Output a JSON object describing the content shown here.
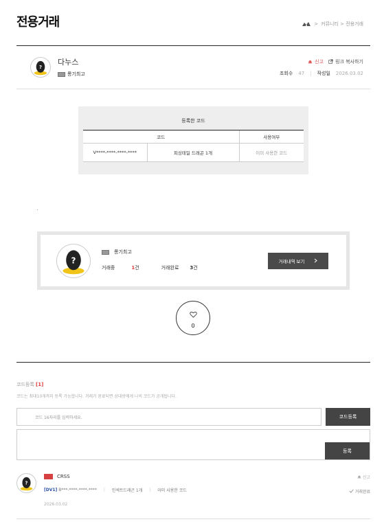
{
  "header": {
    "page_title": "전용거래",
    "breadcrumb_sep": ">",
    "breadcrumb_path": "커뮤니티 > 전용거래"
  },
  "post": {
    "author": "다누스",
    "author_grade": "롱기최고",
    "report_label": "신고",
    "copy_link_label": "링크 복사하기",
    "views_label": "조회수",
    "views": "47",
    "date_label": "작성일",
    "date": "2026.03.02"
  },
  "code_box": {
    "caption": "등록한 코드",
    "headers": [
      "코드",
      "",
      "사용여부"
    ],
    "rows": [
      {
        "code": "V****-****-****-****",
        "item": "피싱테일 드래곤 1개",
        "status": "이미 사용한 코드"
      }
    ]
  },
  "seller": {
    "name": "롱기최고",
    "trading_label": "거래중",
    "trading_count": "1",
    "trading_unit": "건",
    "done_label": "거래완료",
    "done_count": "3",
    "done_unit": "건",
    "history_button": "거래내역 보기"
  },
  "like": {
    "count": "0"
  },
  "code_register": {
    "title": "코드등록",
    "count": "[1]",
    "notice": "코드는 최대10개까지 등록 가능합니다. 거래가 완료되면 상대방에게 나의 코드가 공개됩니다.",
    "input_placeholder": "코드 16자리를 입력하세요.",
    "register_button": "코드등록",
    "submit_button": "등록"
  },
  "comment": {
    "name": "CRSS",
    "tag": "[DV1]",
    "code": "B***-****-****-****",
    "item": "인섹트드래곤 1개",
    "status": "이미 사용한 코드",
    "date": "2026.03.02",
    "report_label": "신고",
    "trade_status": "거래완료"
  },
  "colors": {
    "accent_red": "#e03c3c",
    "button_dark": "#444444",
    "tag_blue": "#2a4ea8"
  },
  "icons": {
    "breadcrumb_home": "home-icon",
    "report": "bell-icon",
    "copy": "external-link-icon",
    "like": "heart-icon",
    "trade_done": "check-icon",
    "history_arrow": "chevron-right-icon"
  }
}
